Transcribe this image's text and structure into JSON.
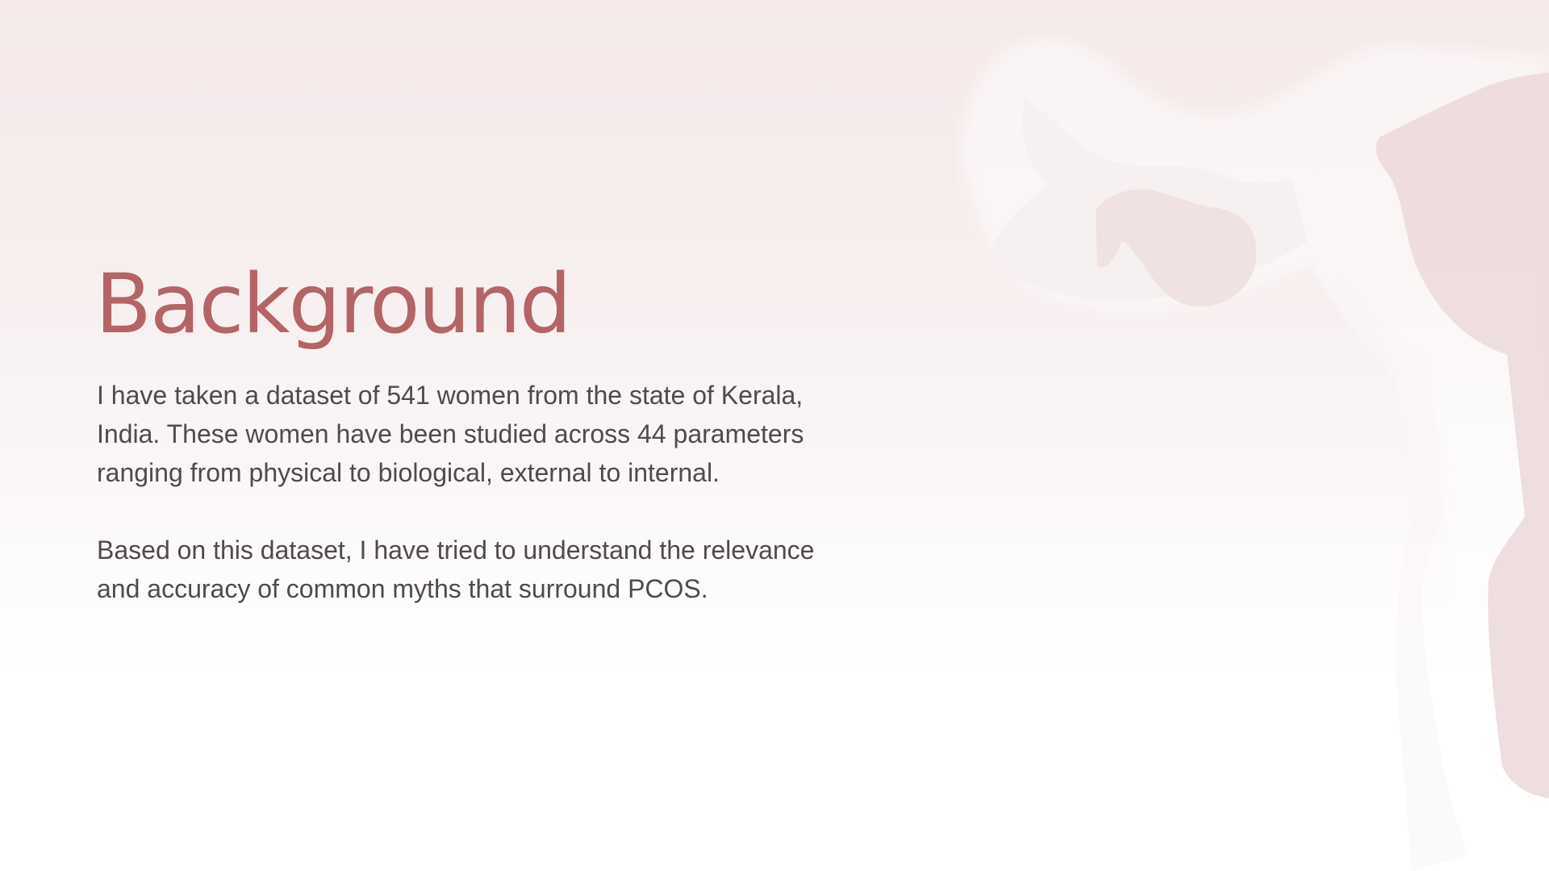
{
  "slide": {
    "title": "Background",
    "paragraphs": [
      "I have taken a dataset of 541 women from the state of Kerala,\nIndia. These women have been studied across 44 parameters\nranging from physical to biological, external to internal.",
      "Based on this dataset, I have tried to understand the relevance\nand accuracy of common myths that surround PCOS."
    ]
  },
  "illustration": {
    "icon": "uterus-icon"
  },
  "colors": {
    "title": "#b46466",
    "body_text": "#4f4b4b",
    "background_top": "#f5e9ea",
    "background_bottom": "#ffffff",
    "illustration_fill": "#efdedf"
  }
}
